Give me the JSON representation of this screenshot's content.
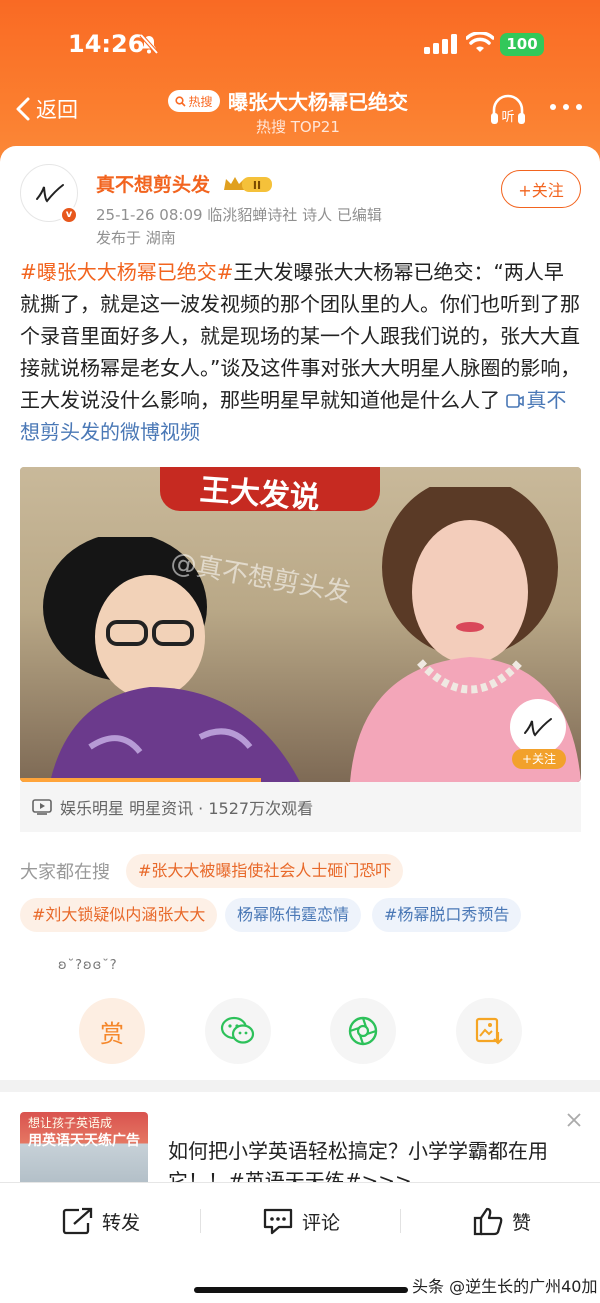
{
  "status_bar": {
    "time": "14:26",
    "battery": "100"
  },
  "nav": {
    "back_label": "返回",
    "hot_badge": "热搜",
    "topic_title": "曝张大大杨幂已绝交",
    "topic_sub": "热搜 TOP21",
    "listen_label": "听"
  },
  "post": {
    "username": "真不想剪头发",
    "level_badge": "II",
    "meta_line": "25-1-26 08:09  临洮貂蝉诗社 诗人  已编辑",
    "location": "发布于 湖南",
    "follow_label": "+关注",
    "tag": "#曝张大大杨幂已绝交#",
    "text": "王大发曝张大大杨幂已绝交：“两人早就撕了，就是这一波发视频的那个团队里的人。你们也听到了那个录音里面好多人，就是现场的某一个人跟我们说的，张大大直接就说杨幂是老女人。”谈及这件事对张大大明星人脉圈的影响，王大发说没什么影响，那些明星早就知道他是什么人了",
    "video_link": "真不想剪头发的微博视频"
  },
  "video": {
    "sign_text": "王大发说",
    "watermark": "@真不想剪头发",
    "follow_label": "+关注",
    "progress": 0.43,
    "info": "娱乐明星 明星资讯 · 1527万次观看"
  },
  "searching": {
    "label": "大家都在搜",
    "chips": [
      "#张大大被曝指使社会人士砸门恐吓",
      "#刘大锁疑似内涵张大大",
      "杨幂陈伟霆恋情",
      "#杨幂脱口秀预告"
    ]
  },
  "actions": {
    "reward_tip": "ʚ˘?ʚɞ˘?",
    "reward_label": "赏"
  },
  "ad": {
    "img_text1": "想让孩子英语成",
    "img_text2": "用英语天天练",
    "img_badge": "广告",
    "text": "如何把小学英语轻松搞定？小学学霸都在用它！！#英语天天练#>>>"
  },
  "bottom": {
    "repost": "转发",
    "comment": "评论",
    "like": "赞"
  },
  "watermark": "头条 @逆生长的广州40加"
}
